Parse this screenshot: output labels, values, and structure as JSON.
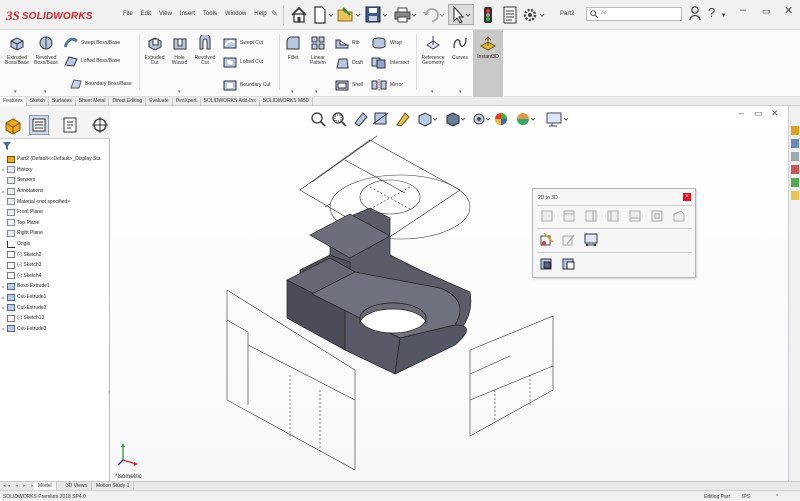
{
  "app": {
    "brand_ds": "3S",
    "brand_name": "SOLIDWORKS",
    "doc_name": "Part2",
    "search_placeholder": "3d"
  },
  "menu": [
    "File",
    "Edit",
    "View",
    "Insert",
    "Tools",
    "Window",
    "Help"
  ],
  "ribbon": {
    "extruded_boss": "Extruded\nBoss/Base",
    "revolved_boss": "Revolved\nBoss/Base",
    "swept_boss": "Swept Boss/Base",
    "lofted_boss": "Lofted Boss/Base",
    "boundary_boss": "Boundary Boss/Base",
    "extruded_cut": "Extruded\nCut",
    "hole_wizard": "Hole\nWizard",
    "revolved_cut": "Revolved\nCut",
    "swept_cut": "Swept Cut",
    "lofted_cut": "Lofted Cut",
    "boundary_cut": "Boundary Cut",
    "fillet": "Fillet",
    "linear_pattern": "Linear\nPattern",
    "rib": "Rib",
    "draft": "Draft",
    "shell": "Shell",
    "wrap": "Wrap",
    "intersect": "Intersect",
    "mirror": "Mirror",
    "reference_geometry": "Reference\nGeometry",
    "curves": "Curves",
    "instant3d": "Instant3D"
  },
  "tabs": [
    "Features",
    "Sketch",
    "Surfaces",
    "Sheet Metal",
    "Direct Editing",
    "Evaluate",
    "DimXpert",
    "SOLIDWORKS Add-Ins",
    "SOLIDWORKS MBD"
  ],
  "tree": [
    {
      "label": "Part2 (Default<<Default>_Display Sta",
      "kind": "part",
      "arrow": ""
    },
    {
      "label": "History",
      "kind": "folder",
      "arrow": "▸"
    },
    {
      "label": "Sensors",
      "kind": "folder",
      "arrow": ""
    },
    {
      "label": "Annotations",
      "kind": "folder",
      "arrow": "▸"
    },
    {
      "label": "Material <not specified>",
      "kind": "folder",
      "arrow": ""
    },
    {
      "label": "Front Plane",
      "kind": "plane",
      "arrow": ""
    },
    {
      "label": "Top Plane",
      "kind": "plane",
      "arrow": ""
    },
    {
      "label": "Right Plane",
      "kind": "plane",
      "arrow": ""
    },
    {
      "label": "Origin",
      "kind": "origin",
      "arrow": ""
    },
    {
      "label": "(-) Sketch2",
      "kind": "sketch",
      "arrow": ""
    },
    {
      "label": "(-) Sketch3",
      "kind": "sketch",
      "arrow": ""
    },
    {
      "label": "(-) Sketch4",
      "kind": "sketch",
      "arrow": ""
    },
    {
      "label": "Boss-Extrude1",
      "kind": "feat",
      "arrow": "▸"
    },
    {
      "label": "Cut-Extrude1",
      "kind": "feat",
      "arrow": "▸"
    },
    {
      "label": "Cut-Extrude2",
      "kind": "feat",
      "arrow": "▸"
    },
    {
      "label": "(-) Sketch13",
      "kind": "sketch",
      "arrow": ""
    },
    {
      "label": "Cut-Extrude3",
      "kind": "feat",
      "arrow": "▸"
    }
  ],
  "toolbar2d3d": {
    "title": "2D to 3D",
    "close": "×"
  },
  "viewport": {
    "view_label": "*Isometric"
  },
  "bottom_tabs": [
    "Model",
    "3D Views",
    "Motion Study 1"
  ],
  "bottom_nav": "◂◂ ◂ ▸ ▸▸",
  "status": {
    "version": "SOLIDWORKS Premium 2018 SP4.0",
    "mode": "Editing Part",
    "units": "IPS"
  },
  "colors": {
    "brand": "#d2232a",
    "solid": "#5a5c68"
  }
}
